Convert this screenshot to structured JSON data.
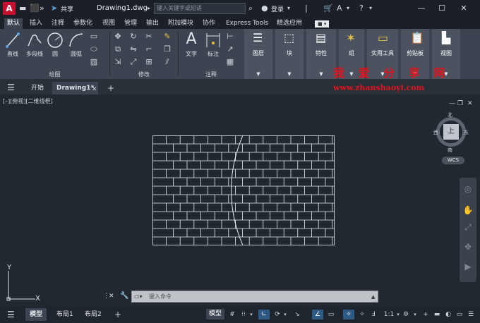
{
  "titlebar": {
    "logo": "A",
    "share": "共享",
    "doc_title": "Drawing1.dwg",
    "search_placeholder": "键入关键字或短语",
    "login": "登录"
  },
  "ribbon_tabs": [
    "默认",
    "插入",
    "注释",
    "参数化",
    "视图",
    "管理",
    "输出",
    "附加模块",
    "协作",
    "Express Tools",
    "精选应用"
  ],
  "ribbon": {
    "draw": {
      "title": "绘图",
      "line": "直线",
      "polyline": "多段线",
      "circle": "圆",
      "arc": "圆弧"
    },
    "modify": {
      "title": "修改"
    },
    "annotation": {
      "title": "注释",
      "text": "文字",
      "dimension": "标注"
    },
    "layers": "图层",
    "block": "块",
    "properties": "特性",
    "group": "组",
    "utilities": "实用工具",
    "clipboard": "剪贴板",
    "view": "视图"
  },
  "watermark": {
    "title": "我 爱 分 享 网",
    "url": "www.zhanshaoyi.com"
  },
  "doc_tabs": {
    "start": "开始",
    "drawing": "Drawing1*"
  },
  "viewport": {
    "label": "[–][俯视][二维线框]",
    "viewcube": {
      "north": "北",
      "south": "南",
      "east": "东",
      "west": "西",
      "face": "上"
    },
    "wcs": "WCS",
    "ucs": {
      "x": "X",
      "y": "Y"
    }
  },
  "command": {
    "placeholder": "键入命令"
  },
  "statusbar": {
    "tabs": [
      "模型",
      "布局1",
      "布局2"
    ],
    "model": "模型",
    "scale": "1:1"
  }
}
